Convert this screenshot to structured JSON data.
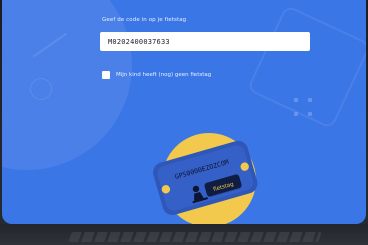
{
  "form": {
    "prompt_label": "Geef de code in op je fietstag",
    "code_value": "M0202400037633",
    "checkbox_label": "Mijn kind heeft (nog) geen fietstag",
    "checkbox_checked": false
  },
  "illustration": {
    "tag_text": "GPS0000EZOZCOM",
    "brand_text": "fietstag"
  },
  "colors": {
    "background_blue": "#3b76e6",
    "accent_yellow": "#f2c94c",
    "tag_blue": "#2f57b7"
  },
  "icons": {
    "dots": "dots-grid-icon",
    "illustration": "bike-tag-illustration-icon"
  }
}
